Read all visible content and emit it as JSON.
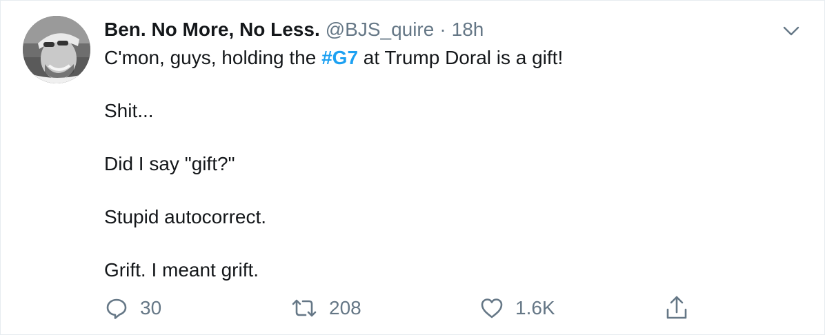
{
  "tweet": {
    "display_name": "Ben. No More, No Less.",
    "handle": "@BJS_quire",
    "separator": "·",
    "time": "18h",
    "lines": {
      "line1_before": "C'mon, guys, holding the ",
      "hashtag": "#G7",
      "line1_after": " at Trump Doral is a gift!",
      "line2": "Shit...",
      "line3": "Did I say \"gift?\"",
      "line4": "Stupid autocorrect.",
      "line5": "Grift. I meant grift."
    },
    "actions": {
      "reply_count": "30",
      "retweet_count": "208",
      "like_count": "1.6K"
    }
  },
  "icons": {
    "avatar": "profile-photo",
    "caret": "chevron-down-icon",
    "reply": "reply-icon",
    "retweet": "retweet-icon",
    "like": "heart-icon",
    "share": "share-icon"
  },
  "colors": {
    "text": "#14171a",
    "secondary": "#657786",
    "link": "#1da1f2",
    "border": "#e6ecf0"
  }
}
